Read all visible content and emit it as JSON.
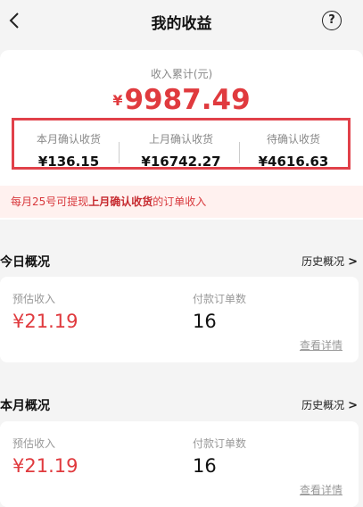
{
  "header": {
    "title": "我的收益",
    "help_icon_glyph": "?"
  },
  "summary": {
    "label": "收入累计(元)",
    "currency": "¥",
    "amount": "9987.49"
  },
  "stats": [
    {
      "label": "本月确认收货",
      "value": "¥136.15"
    },
    {
      "label": "上月确认收货",
      "value": "¥16742.27"
    },
    {
      "label": "待确认收货",
      "value": "¥4616.63"
    }
  ],
  "notice": {
    "prefix": "每月25号可提现",
    "emphasis": "上月确认收货",
    "suffix": "的订单收入"
  },
  "today": {
    "title": "今日概况",
    "history_link": "历史概况",
    "est_label": "预估收入",
    "est_value": "¥21.19",
    "orders_label": "付款订单数",
    "orders_value": "16",
    "detail_link": "查看详情"
  },
  "month": {
    "title": "本月概况",
    "history_link": "历史概况",
    "est_label": "预估收入",
    "est_value": "¥21.19",
    "orders_label": "付款订单数",
    "orders_value": "16",
    "detail_link": "查看详情"
  },
  "colors": {
    "accent_red": "#e03a3e",
    "highlight_border": "#e1414a",
    "notice_bg": "#fff1ef"
  }
}
